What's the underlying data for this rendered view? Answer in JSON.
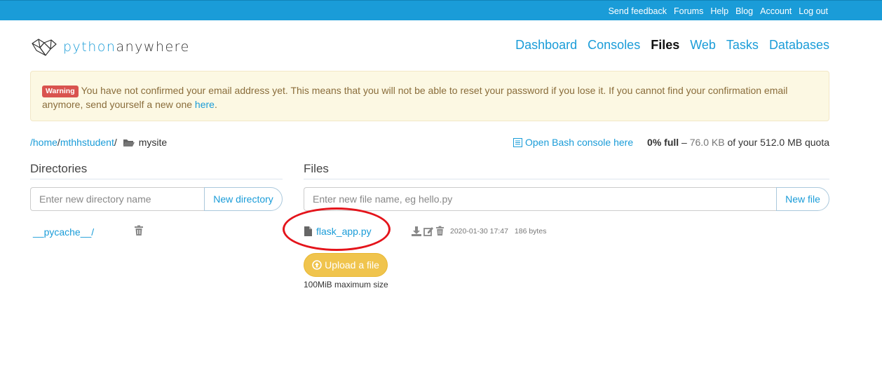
{
  "topbar": {
    "links": [
      "Send feedback",
      "Forums",
      "Help",
      "Blog",
      "Account",
      "Log out"
    ],
    "background": "#1a9cd8"
  },
  "logo": {
    "part1": "python",
    "part2": "anywhere"
  },
  "nav": {
    "items": [
      "Dashboard",
      "Consoles",
      "Files",
      "Web",
      "Tasks",
      "Databases"
    ],
    "active": "Files"
  },
  "alert": {
    "badge": "Warning",
    "message": "You have not confirmed your email address yet. This means that you will not be able to reset your password if you lose it. If you cannot find your confirmation email anymore, send yourself a new one",
    "link": "here",
    "end": "."
  },
  "breadcrumb": {
    "root": "/home",
    "user": "mthhstudent",
    "sep": "/",
    "current": "mysite",
    "folder_icon": "folder-open-icon"
  },
  "bash_link": {
    "label": "Open Bash console here",
    "icon": "console-icon"
  },
  "quota": {
    "percent": "0% full",
    "dash": "–",
    "used": "76.0 KB",
    "suffix": "of your 512.0 MB quota"
  },
  "directories": {
    "title": "Directories",
    "placeholder": "Enter new directory name",
    "button": "New directory",
    "items": [
      {
        "name": "__pycache__/"
      }
    ]
  },
  "files": {
    "title": "Files",
    "placeholder": "Enter new file name, eg hello.py",
    "button": "New file",
    "items": [
      {
        "name": "flask_app.py",
        "modified": "2020-01-30 17:47",
        "size": "186 bytes"
      }
    ]
  },
  "upload": {
    "label": "Upload a file",
    "note": "100MiB maximum size"
  },
  "colors": {
    "link": "#1a9cd8",
    "alert_bg": "#fcf8e3",
    "upload": "#f0c44d",
    "annotation": "#e4141b"
  }
}
